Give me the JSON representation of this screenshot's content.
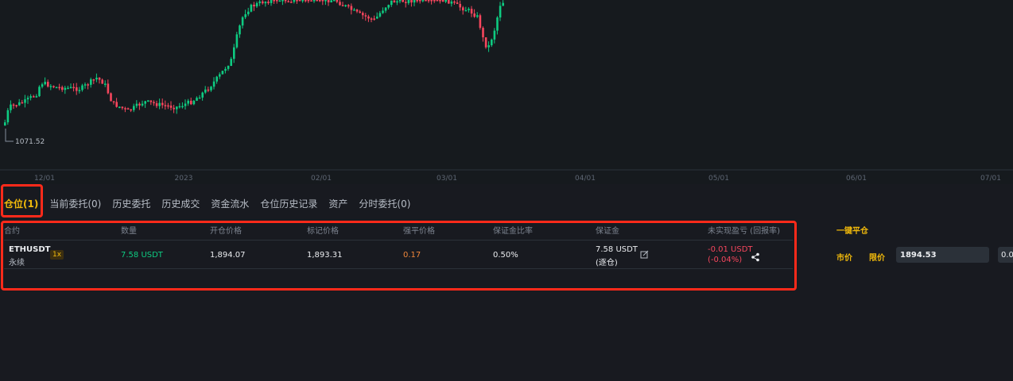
{
  "chart": {
    "low_label": "1071.52",
    "x_ticks": [
      "12/01",
      "2023",
      "02/01",
      "03/01",
      "04/01",
      "05/01",
      "06/01",
      "07/01"
    ]
  },
  "chart_data": {
    "type": "candlestick",
    "x_ticks": [
      "12/01",
      "2023",
      "02/01",
      "03/01",
      "04/01",
      "05/01",
      "06/01",
      "07/01"
    ],
    "annotations": [
      "1071.52"
    ]
  },
  "tabs": [
    {
      "label": "仓位(1)",
      "active": true
    },
    {
      "label": "当前委托(0)"
    },
    {
      "label": "历史委托"
    },
    {
      "label": "历史成交"
    },
    {
      "label": "资金流水"
    },
    {
      "label": "仓位历史记录"
    },
    {
      "label": "资产"
    },
    {
      "label": "分时委托(0)"
    }
  ],
  "columns": {
    "contract": "合约",
    "qty": "数量",
    "entry": "开仓价格",
    "mark": "标记价格",
    "liq": "强平价格",
    "margin_ratio": "保证金比率",
    "margin": "保证金",
    "pnl": "未实现盈亏 (回报率)",
    "close_all": "一键平仓"
  },
  "position": {
    "symbol": "ETHUSDT",
    "type": "永续",
    "leverage": "1x",
    "qty": "7.58 USDT",
    "entry": "1,894.07",
    "mark": "1,893.31",
    "liq": "0.17",
    "margin_ratio": "0.50%",
    "margin_value": "7.58 USDT",
    "margin_mode": "(逐仓)",
    "pnl": "-0.01 USDT",
    "pnl_pct": "(-0.04%)",
    "market_btn": "市价",
    "limit_btn": "限价",
    "price_input": "1894.53",
    "qty_input": "0.0"
  },
  "colors": {
    "up": "#0ecb81",
    "down": "#f6465d",
    "accent": "#f0b90b",
    "highlight": "#ff2a1a"
  }
}
